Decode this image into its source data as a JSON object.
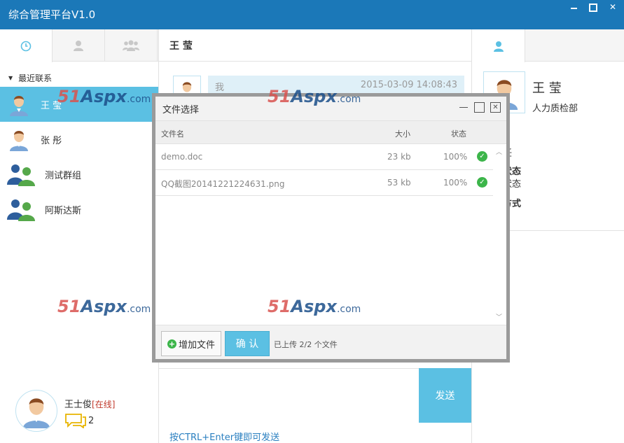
{
  "app": {
    "title": "综合管理平台V1.0"
  },
  "left": {
    "section_title": "最近联系",
    "contacts": [
      {
        "name": "王 莹",
        "type": "user",
        "active": true
      },
      {
        "name": "张 彤",
        "type": "user",
        "active": false
      },
      {
        "name": "测试群组",
        "type": "group",
        "active": false
      },
      {
        "name": "阿斯达斯",
        "type": "group",
        "active": false
      }
    ],
    "me": {
      "name": "王士俊",
      "status": "[在线]",
      "message_count": "2"
    }
  },
  "chat": {
    "title": "王 莹",
    "message": {
      "sender": "我",
      "time": "2015-03-09 14:08:43"
    },
    "send_label": "发送",
    "hint": "按CTRL+Enter键即可发送"
  },
  "profile": {
    "name": "王 莹",
    "department": "人力质检部",
    "fragments": [
      "任",
      "状态",
      "状态",
      "方式"
    ]
  },
  "dialog": {
    "title": "文件选择",
    "columns": {
      "name": "文件名",
      "size": "大小",
      "status": "状态"
    },
    "files": [
      {
        "name": "demo.doc",
        "size": "23 kb",
        "progress": "100%"
      },
      {
        "name": "QQ截图20141221224631.png",
        "size": "53 kb",
        "progress": "100%"
      }
    ],
    "add_label": "增加文件",
    "confirm_label": "确 认",
    "uploaded_text": "已上传 2/2 个文件"
  },
  "watermark": {
    "red": "51",
    "blue": "Aspx",
    "suffix": ".com"
  },
  "colors": {
    "titlebar": "#1b78b8",
    "accent": "#5bc0e3",
    "ok": "#3cb54a",
    "online": "#c0392b"
  },
  "icons": [
    "clock-icon",
    "user-icon",
    "group-icon",
    "chat-bubble-icon"
  ]
}
